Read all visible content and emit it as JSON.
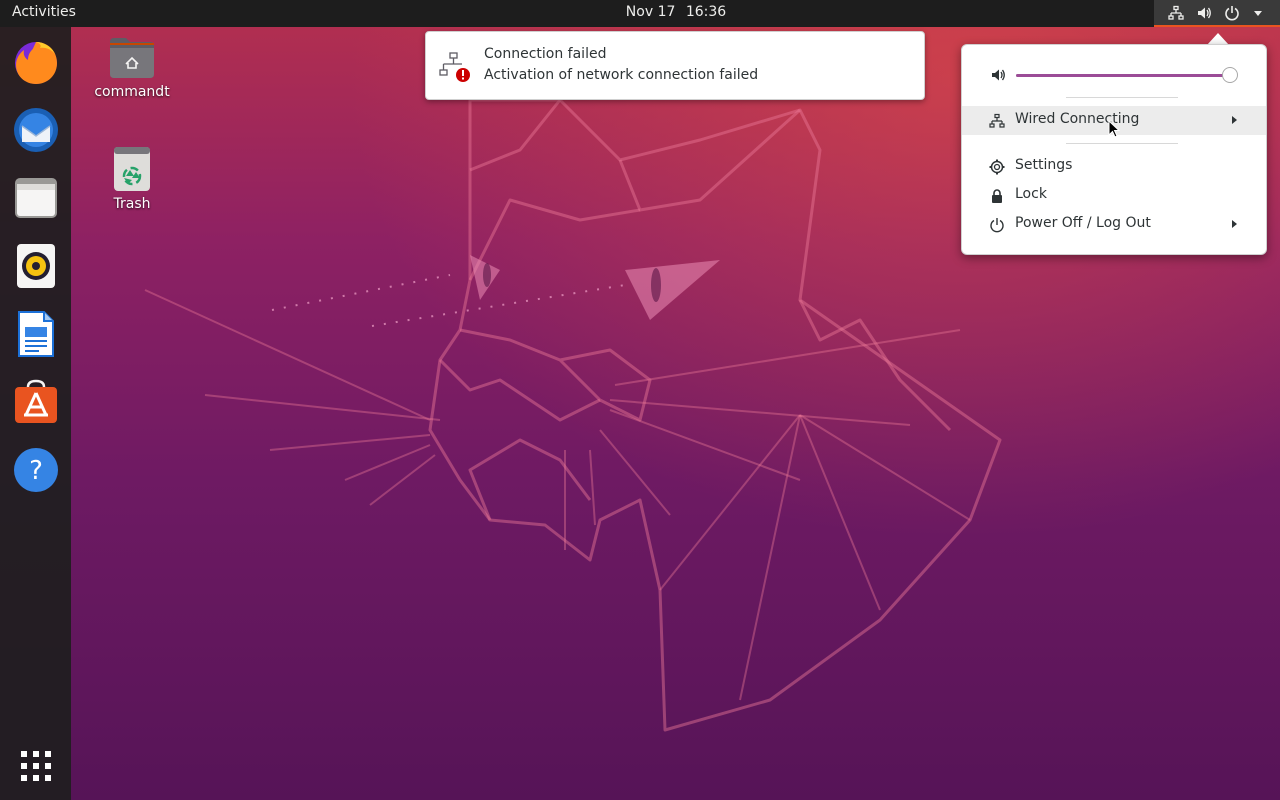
{
  "topbar": {
    "activities_label": "Activities",
    "date": "Nov 17",
    "time": "16:36",
    "status_icons": [
      "network-wired-icon",
      "volume-icon",
      "power-icon",
      "chevron-down-icon"
    ]
  },
  "dock": {
    "items": [
      {
        "name": "firefox-icon"
      },
      {
        "name": "thunderbird-icon"
      },
      {
        "name": "files-icon"
      },
      {
        "name": "rhythmbox-icon"
      },
      {
        "name": "libreoffice-writer-icon"
      },
      {
        "name": "ubuntu-software-icon"
      },
      {
        "name": "help-icon"
      }
    ],
    "apps_grid_icon": "show-applications-icon"
  },
  "desktop": {
    "icons": [
      {
        "label": "commandt",
        "icon": "home-folder-icon"
      },
      {
        "label": "Trash",
        "icon": "trash-icon"
      }
    ]
  },
  "notification": {
    "title": "Connection failed",
    "body": "Activation of network connection failed",
    "icon": "network-error-icon"
  },
  "system_menu": {
    "volume_level": 0.99,
    "items": [
      {
        "label": "Wired Connecting",
        "icon": "network-wired-icon",
        "has_submenu": true,
        "hovered": true
      },
      {
        "label": "Settings",
        "icon": "gear-icon",
        "has_submenu": false
      },
      {
        "label": "Lock",
        "icon": "lock-icon",
        "has_submenu": false
      },
      {
        "label": "Power Off / Log Out",
        "icon": "power-icon",
        "has_submenu": true
      }
    ]
  },
  "colors": {
    "accent": "#e95420",
    "slider": "#9b4c97",
    "topbar": "#1d1d1d",
    "error": "#cc0000"
  }
}
